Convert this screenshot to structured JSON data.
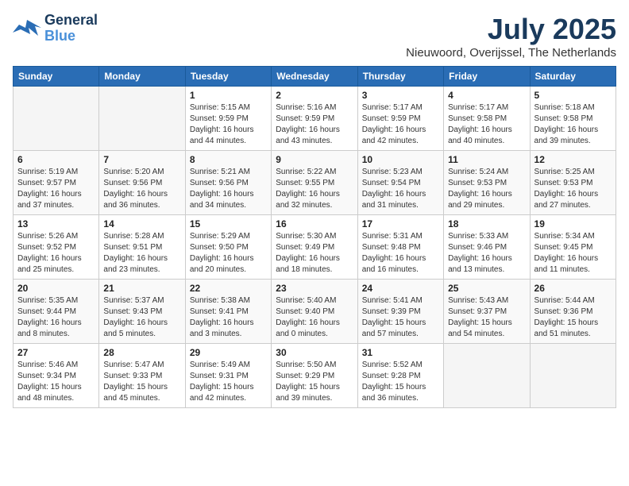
{
  "header": {
    "logo_line1": "General",
    "logo_line2": "Blue",
    "month_title": "July 2025",
    "location": "Nieuwoord, Overijssel, The Netherlands"
  },
  "weekdays": [
    "Sunday",
    "Monday",
    "Tuesday",
    "Wednesday",
    "Thursday",
    "Friday",
    "Saturday"
  ],
  "weeks": [
    [
      {
        "day": "",
        "info": ""
      },
      {
        "day": "",
        "info": ""
      },
      {
        "day": "1",
        "info": "Sunrise: 5:15 AM\nSunset: 9:59 PM\nDaylight: 16 hours and 44 minutes."
      },
      {
        "day": "2",
        "info": "Sunrise: 5:16 AM\nSunset: 9:59 PM\nDaylight: 16 hours and 43 minutes."
      },
      {
        "day": "3",
        "info": "Sunrise: 5:17 AM\nSunset: 9:59 PM\nDaylight: 16 hours and 42 minutes."
      },
      {
        "day": "4",
        "info": "Sunrise: 5:17 AM\nSunset: 9:58 PM\nDaylight: 16 hours and 40 minutes."
      },
      {
        "day": "5",
        "info": "Sunrise: 5:18 AM\nSunset: 9:58 PM\nDaylight: 16 hours and 39 minutes."
      }
    ],
    [
      {
        "day": "6",
        "info": "Sunrise: 5:19 AM\nSunset: 9:57 PM\nDaylight: 16 hours and 37 minutes."
      },
      {
        "day": "7",
        "info": "Sunrise: 5:20 AM\nSunset: 9:56 PM\nDaylight: 16 hours and 36 minutes."
      },
      {
        "day": "8",
        "info": "Sunrise: 5:21 AM\nSunset: 9:56 PM\nDaylight: 16 hours and 34 minutes."
      },
      {
        "day": "9",
        "info": "Sunrise: 5:22 AM\nSunset: 9:55 PM\nDaylight: 16 hours and 32 minutes."
      },
      {
        "day": "10",
        "info": "Sunrise: 5:23 AM\nSunset: 9:54 PM\nDaylight: 16 hours and 31 minutes."
      },
      {
        "day": "11",
        "info": "Sunrise: 5:24 AM\nSunset: 9:53 PM\nDaylight: 16 hours and 29 minutes."
      },
      {
        "day": "12",
        "info": "Sunrise: 5:25 AM\nSunset: 9:53 PM\nDaylight: 16 hours and 27 minutes."
      }
    ],
    [
      {
        "day": "13",
        "info": "Sunrise: 5:26 AM\nSunset: 9:52 PM\nDaylight: 16 hours and 25 minutes."
      },
      {
        "day": "14",
        "info": "Sunrise: 5:28 AM\nSunset: 9:51 PM\nDaylight: 16 hours and 23 minutes."
      },
      {
        "day": "15",
        "info": "Sunrise: 5:29 AM\nSunset: 9:50 PM\nDaylight: 16 hours and 20 minutes."
      },
      {
        "day": "16",
        "info": "Sunrise: 5:30 AM\nSunset: 9:49 PM\nDaylight: 16 hours and 18 minutes."
      },
      {
        "day": "17",
        "info": "Sunrise: 5:31 AM\nSunset: 9:48 PM\nDaylight: 16 hours and 16 minutes."
      },
      {
        "day": "18",
        "info": "Sunrise: 5:33 AM\nSunset: 9:46 PM\nDaylight: 16 hours and 13 minutes."
      },
      {
        "day": "19",
        "info": "Sunrise: 5:34 AM\nSunset: 9:45 PM\nDaylight: 16 hours and 11 minutes."
      }
    ],
    [
      {
        "day": "20",
        "info": "Sunrise: 5:35 AM\nSunset: 9:44 PM\nDaylight: 16 hours and 8 minutes."
      },
      {
        "day": "21",
        "info": "Sunrise: 5:37 AM\nSunset: 9:43 PM\nDaylight: 16 hours and 5 minutes."
      },
      {
        "day": "22",
        "info": "Sunrise: 5:38 AM\nSunset: 9:41 PM\nDaylight: 16 hours and 3 minutes."
      },
      {
        "day": "23",
        "info": "Sunrise: 5:40 AM\nSunset: 9:40 PM\nDaylight: 16 hours and 0 minutes."
      },
      {
        "day": "24",
        "info": "Sunrise: 5:41 AM\nSunset: 9:39 PM\nDaylight: 15 hours and 57 minutes."
      },
      {
        "day": "25",
        "info": "Sunrise: 5:43 AM\nSunset: 9:37 PM\nDaylight: 15 hours and 54 minutes."
      },
      {
        "day": "26",
        "info": "Sunrise: 5:44 AM\nSunset: 9:36 PM\nDaylight: 15 hours and 51 minutes."
      }
    ],
    [
      {
        "day": "27",
        "info": "Sunrise: 5:46 AM\nSunset: 9:34 PM\nDaylight: 15 hours and 48 minutes."
      },
      {
        "day": "28",
        "info": "Sunrise: 5:47 AM\nSunset: 9:33 PM\nDaylight: 15 hours and 45 minutes."
      },
      {
        "day": "29",
        "info": "Sunrise: 5:49 AM\nSunset: 9:31 PM\nDaylight: 15 hours and 42 minutes."
      },
      {
        "day": "30",
        "info": "Sunrise: 5:50 AM\nSunset: 9:29 PM\nDaylight: 15 hours and 39 minutes."
      },
      {
        "day": "31",
        "info": "Sunrise: 5:52 AM\nSunset: 9:28 PM\nDaylight: 15 hours and 36 minutes."
      },
      {
        "day": "",
        "info": ""
      },
      {
        "day": "",
        "info": ""
      }
    ]
  ]
}
